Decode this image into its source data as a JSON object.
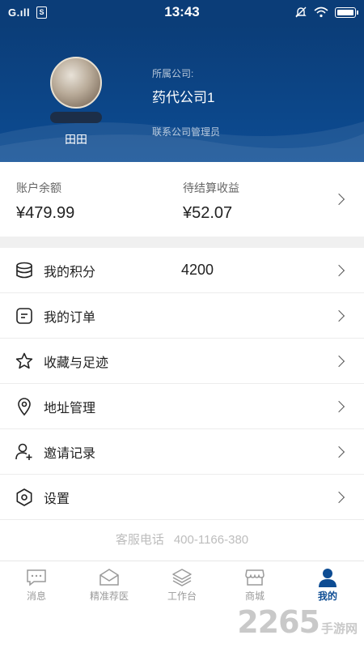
{
  "status_bar": {
    "signal": "G.ıll",
    "sim": "S",
    "time": "13:43"
  },
  "header": {
    "user_name": "田田",
    "company_label": "所属公司:",
    "company_name": "药代公司1",
    "contact_admin": "联系公司管理员"
  },
  "balance": {
    "account_label": "账户余额",
    "account_value": "¥479.99",
    "pending_label": "待结算收益",
    "pending_value": "¥52.07"
  },
  "menu": [
    {
      "label": "我的积分",
      "value": "4200",
      "icon": "coins-icon"
    },
    {
      "label": "我的订单",
      "value": "",
      "icon": "order-icon"
    },
    {
      "label": "收藏与足迹",
      "value": "",
      "icon": "star-icon"
    },
    {
      "label": "地址管理",
      "value": "",
      "icon": "location-icon"
    },
    {
      "label": "邀请记录",
      "value": "",
      "icon": "add-user-icon"
    },
    {
      "label": "设置",
      "value": "",
      "icon": "settings-icon"
    }
  ],
  "service": {
    "label": "客服电话",
    "phone": "400-1166-380"
  },
  "bottom_nav": [
    {
      "label": "消息",
      "icon": "message-icon"
    },
    {
      "label": "精准荐医",
      "icon": "mail-icon"
    },
    {
      "label": "工作台",
      "icon": "layers-icon"
    },
    {
      "label": "商城",
      "icon": "store-icon"
    },
    {
      "label": "我的",
      "icon": "person-icon",
      "active": true
    }
  ],
  "watermark": {
    "number": "2265",
    "text": "手游网"
  },
  "colors": {
    "primary": "#0d4c93",
    "header_dark": "#0b3d78",
    "muted": "#9a9a9a"
  }
}
